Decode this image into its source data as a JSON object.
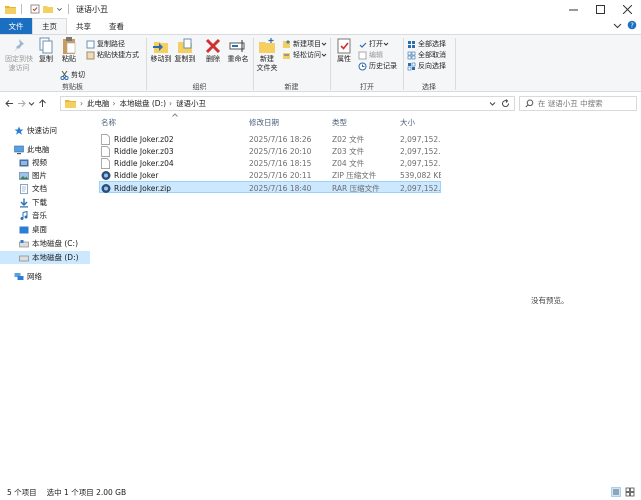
{
  "window": {
    "title": "谜语小丑",
    "colors": {
      "file_tab": "#1a6fc0",
      "selection": "#cce8ff",
      "folder": "#e8b53b"
    }
  },
  "ribbon_tabs": [
    "文件",
    "主页",
    "共享",
    "查看"
  ],
  "ribbon": {
    "clipboard": {
      "label": "剪贴板",
      "pin": "固定到快\n速访问",
      "copy": "复制",
      "paste": "粘贴",
      "copy_path": "复制路径",
      "paste_shortcut": "粘贴快捷方式",
      "cut": "剪切"
    },
    "organize": {
      "label": "组织",
      "move_to": "移动到",
      "copy_to": "复制到",
      "delete": "删除",
      "rename": "重命名"
    },
    "new": {
      "label": "新建",
      "new_folder": "新建\n文件夹",
      "new_item": "新建项目",
      "easy_access": "轻松访问"
    },
    "open": {
      "label": "打开",
      "properties": "属性",
      "open": "打开",
      "edit": "编辑",
      "history": "历史记录"
    },
    "select": {
      "label": "选择",
      "select_all": "全部选择",
      "select_none": "全部取消",
      "invert": "反向选择"
    }
  },
  "address": {
    "crumbs": [
      "此电脑",
      "本地磁盘 (D:)",
      "谜语小丑"
    ],
    "search_placeholder": "在 谜语小丑 中搜索"
  },
  "nav": {
    "quick_access": "快速访问",
    "this_pc": "此电脑",
    "videos": "视频",
    "pictures": "图片",
    "documents": "文档",
    "downloads": "下载",
    "music": "音乐",
    "desktop": "桌面",
    "disk_c": "本地磁盘 (C:)",
    "disk_d": "本地磁盘 (D:)",
    "network": "网络"
  },
  "columns": {
    "name": "名称",
    "modified": "修改日期",
    "type": "类型",
    "size": "大小"
  },
  "files": [
    {
      "name": "Riddle Joker.z02",
      "modified": "2025/7/16 18:26",
      "type": "Z02 文件",
      "size": "2,097,152...",
      "icon": "generic-file-icon"
    },
    {
      "name": "Riddle Joker.z03",
      "modified": "2025/7/16 20:10",
      "type": "Z03 文件",
      "size": "2,097,152...",
      "icon": "generic-file-icon"
    },
    {
      "name": "Riddle Joker.z04",
      "modified": "2025/7/16 18:15",
      "type": "Z04 文件",
      "size": "2,097,152...",
      "icon": "generic-file-icon"
    },
    {
      "name": "Riddle Joker",
      "modified": "2025/7/16 20:11",
      "type": "ZIP 压缩文件",
      "size": "539,082 KB",
      "icon": "archive-icon"
    },
    {
      "name": "Riddle Joker.zip",
      "modified": "2025/7/16 18:40",
      "type": "RAR 压缩文件",
      "size": "2,097,152...",
      "icon": "archive-icon"
    }
  ],
  "preview": "没有预览。",
  "status": {
    "count": "5 个项目",
    "selected": "选中 1 个项目  2.00 GB"
  }
}
